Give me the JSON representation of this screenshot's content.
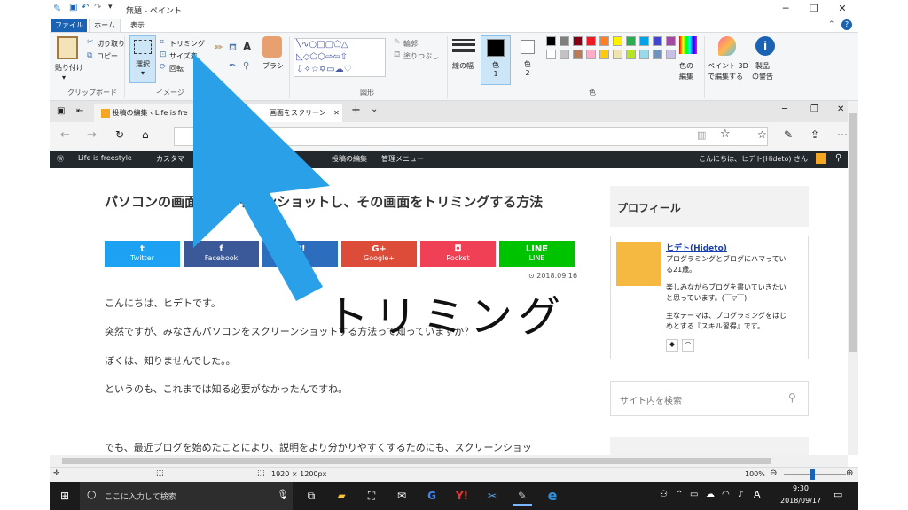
{
  "window": {
    "title": "無題 - ペイント"
  },
  "ribbon_tabs": {
    "file": "ファイル",
    "home": "ホーム",
    "view": "表示"
  },
  "clipboard": {
    "paste": "貼り付け",
    "cut": "切り取り",
    "copy": "コピー",
    "group": "クリップボード"
  },
  "image": {
    "select": "選択",
    "crop": "トリミング",
    "resize": "サイズ変",
    "rotate": "回転",
    "group": "イメージ"
  },
  "tools": {
    "brush": "ブラシ"
  },
  "shapes": {
    "outline": "輪郭",
    "fill": "塗りつぶし",
    "group": "図形"
  },
  "colors": {
    "line_width": "線の幅",
    "color1_a": "色",
    "color1_b": "1",
    "color2_a": "色",
    "color2_b": "2",
    "edit_a": "色の",
    "edit_b": "編集",
    "paint3d_a": "ペイント 3D",
    "paint3d_b": "で編集する",
    "warning_a": "製品",
    "warning_b": "の警告",
    "group": "色",
    "palette": [
      "#000000",
      "#7f7f7f",
      "#880015",
      "#ed1c24",
      "#ff7f27",
      "#fff200",
      "#22b14c",
      "#00a2e8",
      "#3f48cc",
      "#a349a4",
      "#ffffff",
      "#c3c3c3",
      "#b97a57",
      "#ffaec9",
      "#ffc90e",
      "#efe4b0",
      "#b5e61d",
      "#99d9ea",
      "#7092be",
      "#c8bfe7"
    ]
  },
  "browser": {
    "tab1": "投稿の編集 ‹ Life is fre",
    "tab2": "画面をスクリーン",
    "admin": {
      "site": "Life is freestyle",
      "customize": "カスタマ",
      "edit_post": "投稿の編集",
      "admin_menu": "管理メニュー",
      "greeting": "こんにちは、ヒデト(Hideto) さん"
    }
  },
  "article": {
    "title": "パソコンの画面をスクリーンショットし、その画面をトリミングする方法",
    "date": "2018.09.16",
    "share": [
      {
        "label": "Twitter",
        "icon": "t",
        "color": "#1da1f2"
      },
      {
        "label": "Facebook",
        "icon": "f",
        "color": "#3b5998"
      },
      {
        "label": "",
        "icon": "B!",
        "color": "#2c6ebd"
      },
      {
        "label": "Google+",
        "icon": "G+",
        "color": "#dd4b39"
      },
      {
        "label": "Pocket",
        "icon": "◘",
        "color": "#ef4056"
      },
      {
        "label": "LINE",
        "icon": "LINE",
        "color": "#00c300"
      }
    ],
    "p1": "こんにちは、ヒデトです。",
    "p2": "突然ですが、みなさんパソコンをスクリーンショットする方法って知っていますか？",
    "p3": "ぼくは、知りませんでした。。",
    "p4": "というのも、これまでは知る必要がなかったんですね。",
    "p5": "でも、最近ブログを始めたことにより、説明をより分かりやすくするためにも、スクリーンショッ"
  },
  "sidebar": {
    "profile_title": "プロフィール",
    "name": "ヒデト(Hideto)",
    "desc1": "プログラミングとブログにハマってい",
    "desc1b": "る21歳。",
    "desc2": "楽しみながらブログを書いていきたい",
    "desc2b": "と思っています。(￣▽￣)",
    "desc3": "主なテーマは、プログラミングをはじ",
    "desc3b": "めとする『スキル習得』です。",
    "search_placeholder": "サイト内を検索"
  },
  "overlay": {
    "text": "トリミング"
  },
  "status": {
    "size": "1920 × 1200px",
    "zoom": "100%"
  },
  "taskbar": {
    "search": "ここに入力して検索",
    "time": "9:30",
    "date": "2018/09/17"
  }
}
